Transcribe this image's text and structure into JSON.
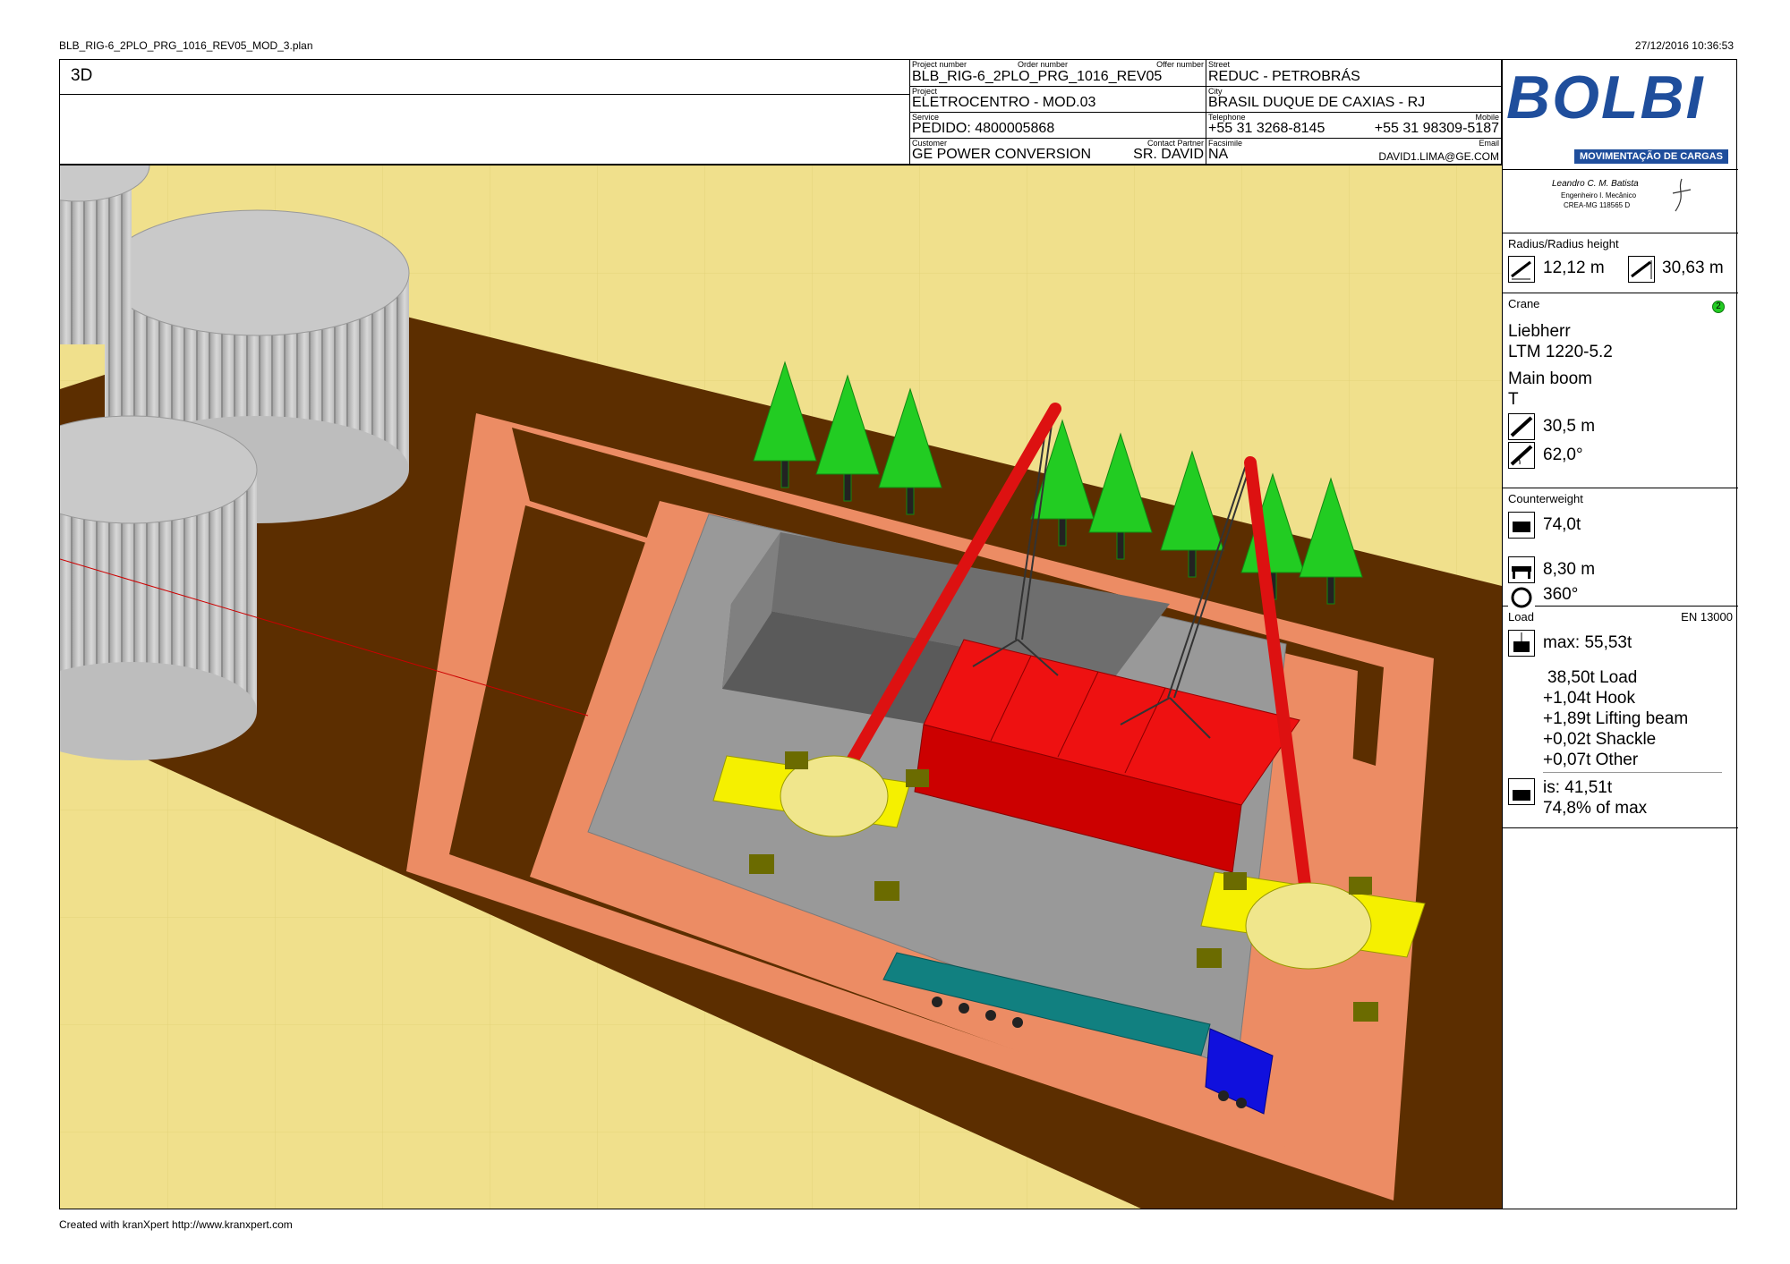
{
  "top_bar": {
    "file_name": "BLB_RIG-6_2PLO_PRG_1016_REV05_MOD_3.plan",
    "datetime": "27/12/2016 10:36:53"
  },
  "footer": {
    "credit": "Created with kranXpert   http://www.kranxpert.com"
  },
  "view": {
    "title": "3D"
  },
  "header": {
    "labels": {
      "project_number": "Project number",
      "order_number": "Order number",
      "offer_number": "Offer number",
      "project": "Project",
      "service": "Service",
      "customer": "Customer",
      "contact_partner": "Contact Partner",
      "street": "Street",
      "city": "City",
      "telephone": "Telephone",
      "mobile": "Mobile",
      "facsimile": "Facsimile",
      "email": "Email"
    },
    "values": {
      "project_number": "BLB_RIG-6_2PLO_PRG_1016_REV05",
      "project": "ELETROCENTRO - MOD.03",
      "service": "PEDIDO: 4800005868",
      "customer": "GE POWER CONVERSION",
      "contact_partner": "SR. DAVID",
      "street": "REDUC - PETROBRÁS",
      "city": "BRASIL DUQUE DE CAXIAS - RJ",
      "telephone": "+55 31 3268-8145",
      "mobile": "+55 31 98309-5187",
      "facsimile": "NA",
      "email": "DAVID1.LIMA@GE.COM"
    }
  },
  "brand": {
    "logo_text": "BOLBI",
    "logo_subtitle": "MOVIMENTAÇÃO DE CARGAS",
    "signature_name": "Leandro C. M. Batista",
    "signature_role": "Engenheiro I. Mecânico",
    "signature_crea": "CREA-MG 118565 D",
    "logo_color": "#1f4e9c"
  },
  "radius": {
    "title": "Radius/Radius height",
    "radius": "12,12 m",
    "radius_height": "30,63 m"
  },
  "crane": {
    "title": "Crane",
    "badge": "2",
    "manufacturer": "Liebherr",
    "model": "LTM 1220-5.2",
    "boom": "Main boom",
    "boom_type": "T",
    "boom_length": "30,5 m",
    "boom_angle": "62,0°"
  },
  "counterweight": {
    "title": "Counterweight",
    "weight": "74,0t",
    "outrigger_base": "8,30 m",
    "slewing": "360°"
  },
  "load": {
    "title": "Load",
    "standard": "EN 13000",
    "max": "max: 55,53t",
    "items": [
      "38,50t Load",
      "+1,04t Hook",
      "+1,89t Lifting beam",
      "+0,02t Shackle",
      "+0,07t Other"
    ],
    "actual": "is: 41,51t",
    "utilization": "74,8% of max"
  },
  "colors": {
    "ground": "#f0e08c",
    "dirt": "#5c2e00",
    "pad": "#ec8c64",
    "concrete": "#999999",
    "boom": "#dd1111",
    "load_module": "#ee1111",
    "crane_body": "#f5f000",
    "trailer": "#118080",
    "truck_cab": "#1010dd",
    "tree": "#22cc22",
    "tank": "#c9c9c9"
  }
}
